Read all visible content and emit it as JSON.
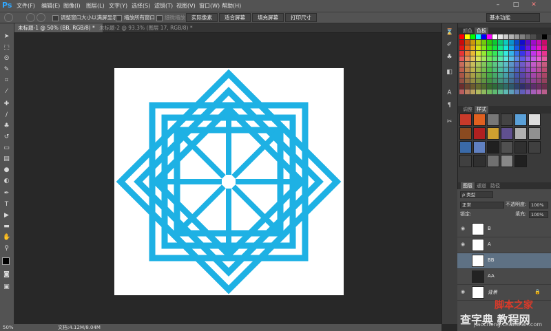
{
  "app": {
    "logo": "Ps"
  },
  "menubar": {
    "items": [
      "文件(F)",
      "编辑(E)",
      "图像(I)",
      "图层(L)",
      "文字(Y)",
      "选择(S)",
      "滤镜(T)",
      "视图(V)",
      "窗口(W)",
      "帮助(H)"
    ],
    "window_buttons": [
      "–",
      "□",
      "✕"
    ]
  },
  "options": {
    "resize_window_label": "调整窗口大小以满屏显示",
    "zoom_all_label": "缩放所有窗口",
    "scrubby_zoom_label": "细微缩放",
    "actual_pixels": "实际像素",
    "fit_screen": "适合屏幕",
    "fill_screen": "填充屏幕",
    "print_size": "打印尺寸",
    "workspace": "基本功能"
  },
  "documents": [
    {
      "title": "未标题-1 @ 50% (BB, RGB/8) *",
      "close": "×",
      "active": true
    },
    {
      "title": "未标题-2 @ 93.3% (图层 17, RGB/8) *",
      "close": "×",
      "active": false
    }
  ],
  "status": {
    "zoom": "50%",
    "doc_info": "文档:4.12M/8.04M"
  },
  "panels": {
    "color_tabs": [
      "颜色",
      "色板"
    ],
    "adjust_tabs": [
      "调整",
      "样式"
    ],
    "layer_tabs": [
      "图层",
      "通道",
      "路径"
    ],
    "filter_kind": "ρ 类型",
    "blend_mode": "正常",
    "opacity_label": "不透明度:",
    "opacity_value": "100%",
    "lock_label": "锁定:",
    "fill_label": "填充:",
    "fill_value": "100%"
  },
  "layers": [
    {
      "name": "B",
      "selected": false
    },
    {
      "name": "A",
      "selected": false
    },
    {
      "name": "BB",
      "selected": true
    },
    {
      "name": "AA",
      "selected": false
    },
    {
      "name": "背景",
      "selected": false
    }
  ],
  "artwork": {
    "color": "#1eb1e4",
    "background": "#ffffff"
  },
  "watermark": {
    "line1": "脚本之家",
    "line2": "查字典 教程网",
    "line3": "jiaocheng.chazidian.com"
  }
}
